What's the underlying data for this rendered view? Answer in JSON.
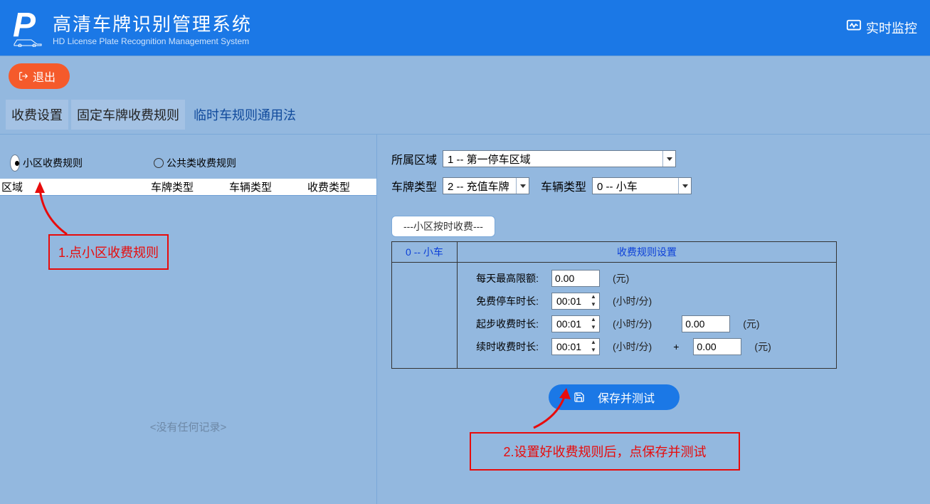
{
  "header": {
    "title": "高清车牌识别管理系统",
    "subtitle": "HD License Plate Recognition Management System",
    "monitor": "实时监控"
  },
  "exit": "退出",
  "tabs": {
    "t1": "收费设置",
    "t2": "固定车牌收费规则",
    "t3": "临时车规则通用法"
  },
  "left": {
    "radio1": "小区收费规则",
    "radio2": "公共类收费规则",
    "cols": {
      "c1": "区域",
      "c2": "车牌类型",
      "c3": "车辆类型",
      "c4": "收费类型"
    },
    "annot": "1.点小区收费规则",
    "empty": "<没有任何记录>"
  },
  "right": {
    "area_label": "所属区域",
    "area_value": "1 -- 第一停车区域",
    "plate_label": "车牌类型",
    "plate_value": "2 -- 充值车牌",
    "vtype_label": "车辆类型",
    "vtype_value": "0 -- 小车",
    "inner_tab": "---小区按时收费---",
    "grid_h1": "0 -- 小车",
    "grid_h2": "收费规则设置",
    "r1_label": "每天最高限额:",
    "r1_val": "0.00",
    "r1_unit": "(元)",
    "r2_label": "免费停车时长:",
    "r2_val": "00:01",
    "r2_unit": "(小时/分)",
    "r3_label": "起步收费时长:",
    "r3_val": "00:01",
    "r3_unit": "(小时/分)",
    "r3_val2": "0.00",
    "r3_unit2": "(元)",
    "r4_label": "续时收费时长:",
    "r4_val": "00:01",
    "r4_unit": "(小时/分)",
    "r4_plus": "+",
    "r4_val2": "0.00",
    "r4_unit2": "(元)",
    "save": "保存并测试",
    "annot": "2.设置好收费规则后，点保存并测试"
  }
}
